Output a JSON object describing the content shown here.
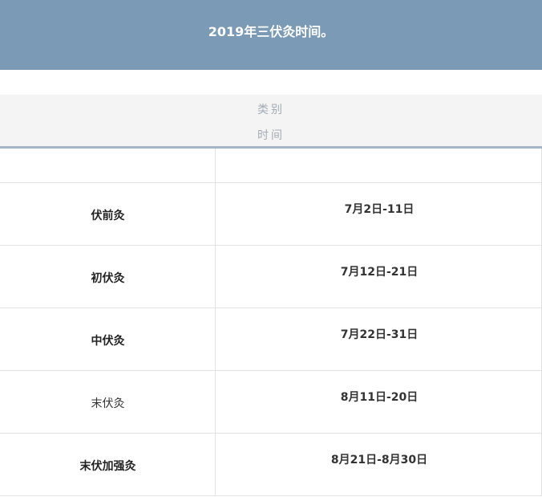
{
  "banner": {
    "title": "2019年三伏灸时间。"
  },
  "table": {
    "header_line1": "类别",
    "header_line2": "时间",
    "rows": [
      {
        "category": "伏前灸",
        "time": "7月2日-11日"
      },
      {
        "category": "初伏灸",
        "time": "7月12日-21日"
      },
      {
        "category": "中伏灸",
        "time": "7月22日-31日"
      },
      {
        "category": "末伏灸",
        "time": "8月11日-20日"
      },
      {
        "category": "末伏加强灸",
        "time": "8月21日-8月30日"
      }
    ]
  },
  "colors": {
    "banner_bg": "#7a9ab5",
    "header_bg": "#f4f4f4",
    "header_text": "#a3acb5",
    "header_rule": "#a3b5c6",
    "grid_line": "#e3e3e3"
  }
}
